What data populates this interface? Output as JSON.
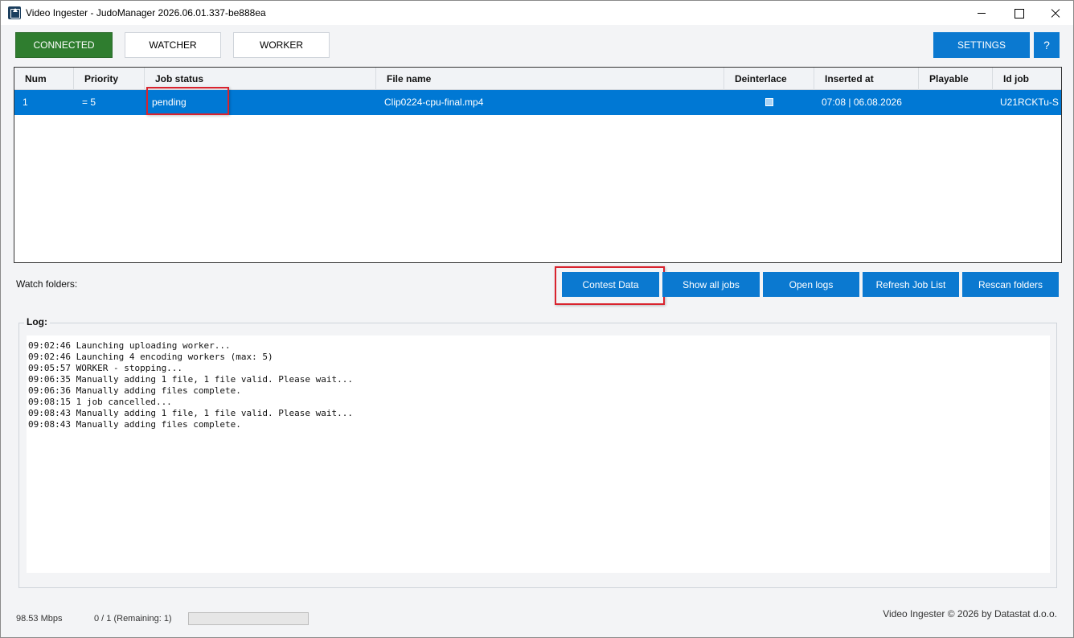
{
  "window": {
    "title": "Video Ingester - JudoManager  2026.06.01.337-be888ea"
  },
  "toolbar": {
    "connected_label": "CONNECTED",
    "watcher_label": "WATCHER",
    "worker_label": "WORKER",
    "settings_label": "SETTINGS",
    "help_label": "?"
  },
  "grid": {
    "columns": [
      "Num",
      "Priority",
      "Job status",
      "File name",
      "Deinterlace",
      "Inserted at",
      "Playable",
      "Id job"
    ],
    "rows": [
      {
        "num": "1",
        "priority": "= 5",
        "status": "pending",
        "file_name": "Clip0224-cpu-final.mp4",
        "deinterlace": false,
        "inserted_at": "07:08 | 06.08.2026",
        "playable": "",
        "id_job": "U21RCKTu-S"
      }
    ]
  },
  "watch_folders_label": "Watch folders:",
  "actions": {
    "contest_data": "Contest Data",
    "show_all_jobs": "Show all jobs",
    "open_logs": "Open logs",
    "refresh_job_list": "Refresh Job List",
    "rescan_folders": "Rescan folders"
  },
  "log": {
    "title": "Log:",
    "lines": [
      "09:02:46 Launching uploading worker...",
      "09:02:46 Launching 4 encoding workers (max: 5)",
      "09:05:57 WORKER - stopping...",
      "09:06:35 Manually adding 1 file, 1 file valid. Please wait...",
      "09:06:36 Manually adding files complete.",
      "09:08:15 1 job cancelled...",
      "09:08:43 Manually adding 1 file, 1 file valid. Please wait...",
      "09:08:43 Manually adding files complete."
    ]
  },
  "status": {
    "speed": "98.53 Mbps",
    "count": "0 / 1 (Remaining: 1)",
    "progress_fraction": 0,
    "copyright": "Video Ingester © 2026 by Datastat d.o.o."
  }
}
